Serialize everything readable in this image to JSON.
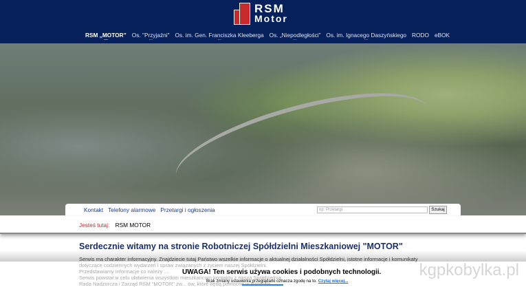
{
  "logo": {
    "line1": "RSM",
    "line2": "Motor"
  },
  "nav": [
    {
      "label": "RSM „MOTOR”",
      "active": true
    },
    {
      "label": "Os. \"Przyjaźni\""
    },
    {
      "label": "Os. im. Gen. Franciszka Kleeberga"
    },
    {
      "label": "Os. „Niepodległości”"
    },
    {
      "label": "Os. im. Ignacego Daszyńskiego"
    },
    {
      "label": "RODO"
    },
    {
      "label": "eBOK"
    }
  ],
  "subnav": [
    "Kontakt",
    "Telefony alarmowe",
    "Przetargi i ogłoszenia"
  ],
  "search": {
    "placeholder": "np: Przetargi",
    "button": "Szukaj"
  },
  "breadcrumb": {
    "label": "Jesteś tutaj:",
    "current": "RSM MOTOR"
  },
  "content": {
    "title": "Serdecznie witamy na stronie Robotniczej Spółdzielni Mieszkaniowej \"MOTOR\"",
    "paragraph": "Serwis ma charakter informacyjny. Znajdziecie tutaj Państwo wszelkie informacje o aktualnej działalności Spółdzielni, istotne informacje i komunikaty",
    "faded": [
      "dotyczące codziennych wydarzeń i spraw związanych z życiem naszej Spółdzielni.",
      "Przedstawiamy informacje co należy ...",
      "Serwis powstał w celu ułatwienia wszystkim mieszkańcom kontaktu z naszą Spółdzielnią.",
      "Rada Nadzorcza i Zarząd RSM \"MOTOR\" zw... ów, które będą pomocne w Państwa"
    ]
  },
  "cookie": {
    "title": "UWAGA! Ten serwis używa cookies i podobnych technologii.",
    "text": "Brak zmiany ustawienia przeglądarki oznacza zgodę na to.",
    "link": "Czytaj więcej..."
  },
  "watermark": "kgpkobylka.pl"
}
